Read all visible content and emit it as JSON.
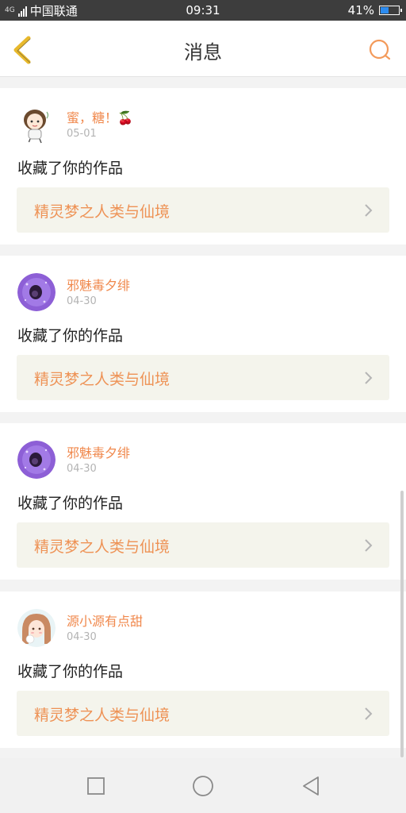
{
  "status_bar": {
    "network": "4G",
    "carrier": "中国联通",
    "time": "09:31",
    "battery_percent": "41%",
    "battery_level": 0.41,
    "battery_color": "#2d8cf0"
  },
  "header": {
    "title": "消息",
    "back_icon": "chevron-left-icon",
    "search_icon": "search-icon",
    "accent_back": "#e8b92c",
    "accent_search": "#f39a5a"
  },
  "notifications": [
    {
      "user": "蜜，糖！🍒",
      "date": "05-01",
      "action": "收藏了你的作品",
      "work_title": "精灵梦之人类与仙境",
      "avatar": "cartoon-girl-avatar"
    },
    {
      "user": "邪魅毒夕绯",
      "date": "04-30",
      "action": "收藏了你的作品",
      "work_title": "精灵梦之人类与仙境",
      "avatar": "purple-avatar"
    },
    {
      "user": "邪魅毒夕绯",
      "date": "04-30",
      "action": "收藏了你的作品",
      "work_title": "精灵梦之人类与仙境",
      "avatar": "purple-avatar"
    },
    {
      "user": "源小源有点甜",
      "date": "04-30",
      "action": "收藏了你的作品",
      "work_title": "精灵梦之人类与仙境",
      "avatar": "anime-girl-avatar"
    }
  ],
  "colors": {
    "username": "#f0884c",
    "work_title": "#ee9255",
    "work_row_bg": "#f4f4ec"
  },
  "nav_bar": {
    "recent_icon": "square-icon",
    "home_icon": "circle-icon",
    "back_icon": "triangle-back-icon"
  }
}
